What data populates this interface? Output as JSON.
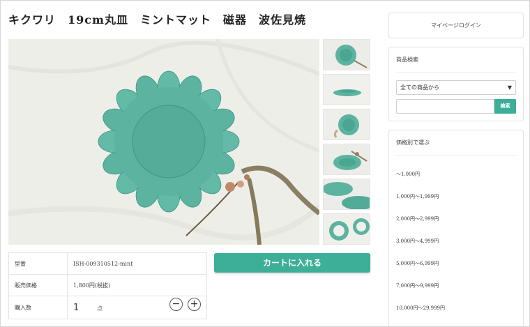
{
  "product": {
    "title": "キクワリ　19cm丸皿　ミントマット　磁器　波佐見焼",
    "colors": {
      "plate": "#5cb3a0",
      "plate_dark": "#3e9683",
      "background": "#efefea"
    }
  },
  "info": {
    "rows": [
      {
        "label": "型番",
        "value": "ISH-009310512-mint"
      },
      {
        "label": "販売価格",
        "value": "1,800円(税抜)"
      }
    ],
    "qty_label": "購入数",
    "qty_value": "1",
    "qty_unit": "点",
    "minus": "−",
    "plus": "+"
  },
  "cart_button": "カートに入れる",
  "sidebar": {
    "login": "マイページログイン",
    "search": {
      "heading": "商品検索",
      "select_value": "全ての商品から",
      "keyword_value": "",
      "button": "検索"
    },
    "price": {
      "heading": "価格別で選ぶ",
      "items": [
        "〜1,000円",
        "1,000円〜1,999円",
        "2,000円〜2,999円",
        "3,000円〜4,999円",
        "5,000円〜6,999円",
        "7,000円〜9,999円",
        "10,000円〜29,999円"
      ]
    }
  },
  "accent_color": "#3dae98"
}
